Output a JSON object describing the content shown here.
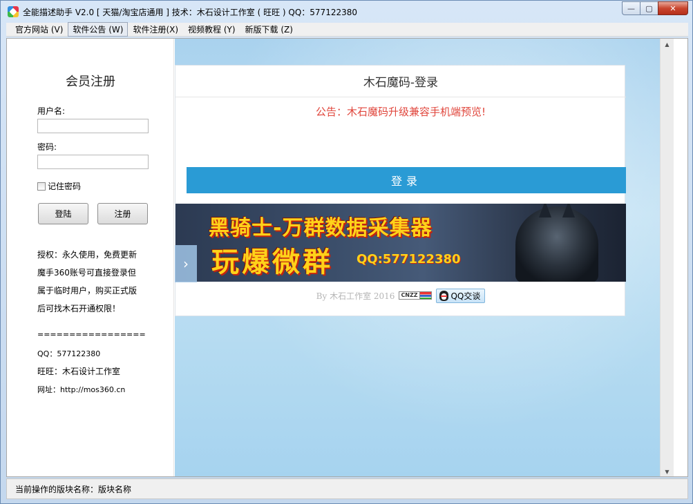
{
  "window": {
    "title": "全能描述助手 V2.0 [ 天猫/淘宝店通用 ]  技术：木石设计工作室 ( 旺旺 )  QQ：577122380",
    "controls": {
      "minimize": "—",
      "maximize": "▢",
      "close": "✕"
    }
  },
  "menu": [
    {
      "label": "官方网站 (V)"
    },
    {
      "label": "软件公告 (W)",
      "active": true
    },
    {
      "label": "软件注册(X)"
    },
    {
      "label": "视频教程 (Y)"
    },
    {
      "label": "新版下载 (Z)"
    }
  ],
  "left_panel": {
    "title": "会员注册",
    "username_label": "用户名:",
    "username_value": "",
    "password_label": "密码:",
    "password_value": "",
    "remember_label": "记住密码",
    "remember_checked": false,
    "login_button": "登陆",
    "register_button": "注册",
    "info": [
      "授权：永久使用，免费更新",
      "魔手360账号可直接登录但",
      "属于临时用户，购买正式版",
      "后可找木石开通权限！"
    ],
    "separator": "=================",
    "qq": "QQ：577122380",
    "wangwang": "旺旺：木石设计工作室",
    "website": "网址：http://mos360.cn"
  },
  "login_box": {
    "title": "木石魔码-登录",
    "notice": "公告：木石魔码升级兼容手机端预览!",
    "login_button": "登录",
    "banner": {
      "line1": "黑骑士-万群数据采集器",
      "line2": "玩爆微群",
      "qq": "QQ:577122380"
    },
    "byline": "By 木石工作室  2016",
    "cnzz": "CNZZ",
    "qq_button": "QQ交谈"
  },
  "side_toggle": "›",
  "scrollbar": {
    "up": "▲",
    "down": "▼"
  },
  "statusbar": {
    "text": "当前操作的版块名称：版块名称"
  }
}
